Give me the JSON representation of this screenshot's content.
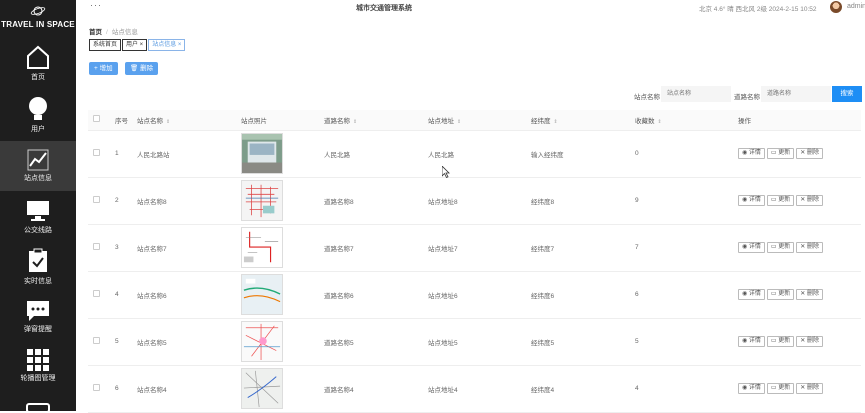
{
  "sidebar": {
    "brand": "TRAVEL IN SPACE",
    "items": [
      {
        "label": "首页",
        "icon": "home-icon"
      },
      {
        "label": "用户",
        "icon": "lightbulb-icon"
      },
      {
        "label": "站点信息",
        "icon": "chart-icon"
      },
      {
        "label": "公交线路",
        "icon": "monitor-icon"
      },
      {
        "label": "实时信息",
        "icon": "clipboard-icon"
      },
      {
        "label": "弹窗提醒",
        "icon": "chat-icon"
      },
      {
        "label": "轮播图管理",
        "icon": "grid-icon"
      }
    ]
  },
  "topbar": {
    "menu_dots": "···",
    "system_title": "城市交通管理系统",
    "weather": "北京  4.6°  晴  西北风  2级  2024-2-15 10:52",
    "username": "admin"
  },
  "breadcrumb": {
    "home": "首页",
    "separator": "/",
    "current": "站点信息"
  },
  "tabs": [
    {
      "label": "系统首页"
    },
    {
      "label": "用户 ×"
    },
    {
      "label": "站点信息 ×"
    }
  ],
  "toolbar": {
    "add_label": "+ 增加",
    "delete_label": "删除"
  },
  "filters": {
    "station_label": "站点名称",
    "station_placeholder": "站点名称",
    "road_label": "道路名称",
    "road_placeholder": "道路名称",
    "search_label": "搜索"
  },
  "table": {
    "headers": [
      "序号",
      "站点名称",
      "站点照片",
      "道路名称",
      "站点地址",
      "经纬度",
      "收藏数",
      "操作"
    ],
    "actions": [
      "详情",
      "更新",
      "删除"
    ],
    "rows": [
      {
        "no": "1",
        "name": "人民北路站",
        "road": "人民北路",
        "address": "人民北路",
        "coords": "输入经纬度",
        "favorites": "0"
      },
      {
        "no": "2",
        "name": "站点名称8",
        "road": "道路名称8",
        "address": "站点地址8",
        "coords": "经纬度8",
        "favorites": "9"
      },
      {
        "no": "3",
        "name": "站点名称7",
        "road": "道路名称7",
        "address": "站点地址7",
        "coords": "经纬度7",
        "favorites": "7"
      },
      {
        "no": "4",
        "name": "站点名称6",
        "road": "道路名称6",
        "address": "站点地址6",
        "coords": "经纬度6",
        "favorites": "6"
      },
      {
        "no": "5",
        "name": "站点名称5",
        "road": "道路名称5",
        "address": "站点地址5",
        "coords": "经纬度5",
        "favorites": "5"
      },
      {
        "no": "6",
        "name": "站点名称4",
        "road": "道路名称4",
        "address": "站点地址4",
        "coords": "经纬度4",
        "favorites": "4"
      }
    ]
  }
}
